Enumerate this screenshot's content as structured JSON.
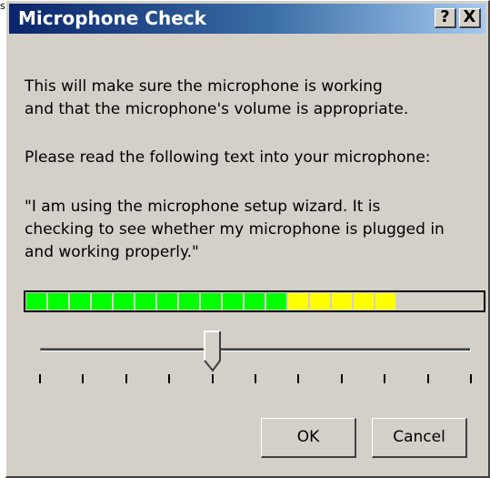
{
  "page": {
    "corner_text": "s"
  },
  "dialog": {
    "title": "Microphone Check",
    "help_label": "?",
    "close_label": "X"
  },
  "content": {
    "intro_line_1": "This will make sure the microphone is working",
    "intro_line_2": "and that the microphone's volume is appropriate.",
    "instruction": "Please read the following text into your microphone:",
    "quote_line_1": "\"I am using the microphone setup wizard. It is",
    "quote_line_2": "checking to see whether my microphone is plugged in",
    "quote_line_3": "and working properly.\""
  },
  "meter": {
    "total_segments": 21,
    "green_segments": 12,
    "yellow_segments": 5,
    "colors": {
      "green": "#00ff00",
      "yellow": "#ffff00",
      "empty": "#d4d0c8"
    }
  },
  "volume_slider": {
    "value_fraction": 0.4,
    "tick_count": 11
  },
  "buttons": {
    "ok_label": "OK",
    "cancel_label": "Cancel"
  },
  "colors": {
    "dialog_face": "#d4d0c8",
    "title_start": "#0a246a",
    "title_end": "#a6caf0"
  }
}
